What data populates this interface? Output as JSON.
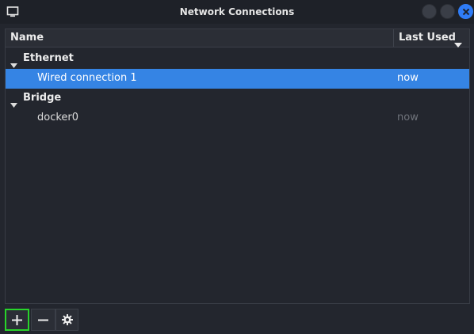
{
  "window": {
    "title": "Network Connections"
  },
  "columns": {
    "name": "Name",
    "last_used": "Last Used"
  },
  "groups": [
    {
      "label": "Ethernet",
      "connections": [
        {
          "name": "Wired connection 1",
          "last_used": "now",
          "selected": true
        }
      ]
    },
    {
      "label": "Bridge",
      "connections": [
        {
          "name": "docker0",
          "last_used": "now",
          "selected": false
        }
      ]
    }
  ],
  "colors": {
    "selection": "#3584e4",
    "close_button": "#2f7cf6",
    "add_button_highlight": "#28d42a"
  },
  "icons": {
    "app": "monitor-icon",
    "sort": "chevron-down-icon",
    "expander": "triangle-down-icon",
    "add": "plus-icon",
    "remove": "minus-icon",
    "settings": "gear-icon"
  }
}
